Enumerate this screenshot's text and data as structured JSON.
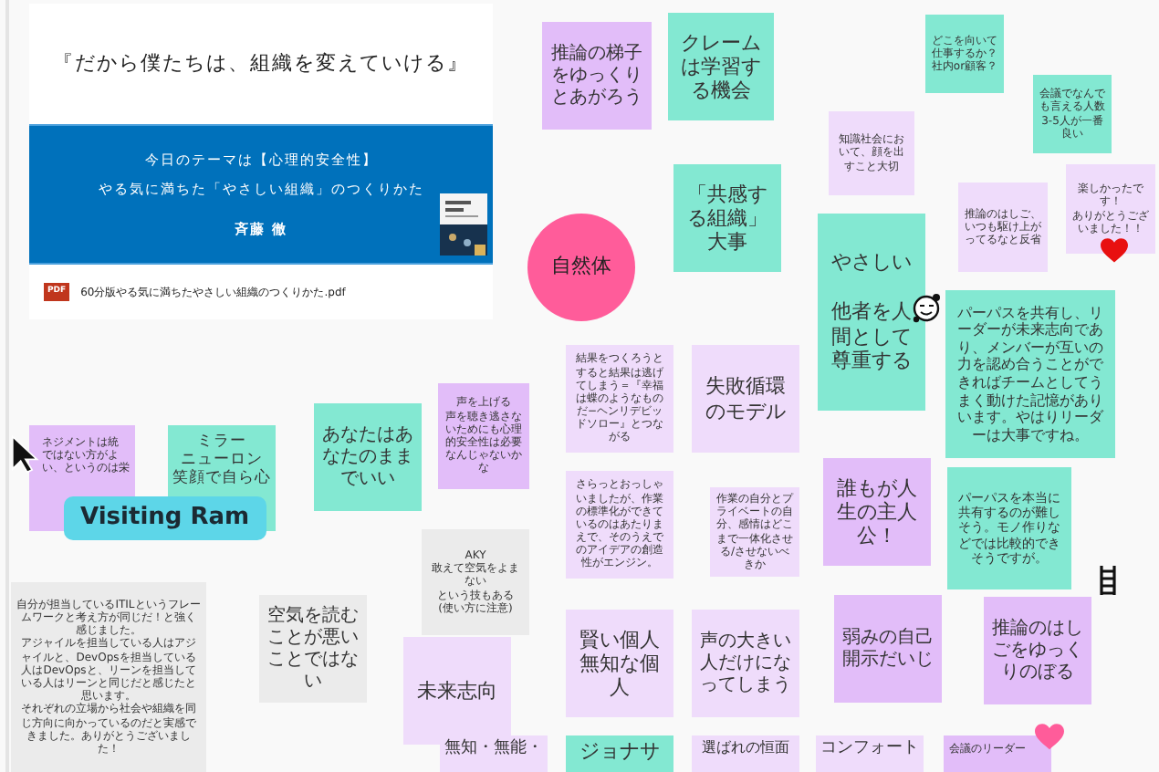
{
  "pdf_card": {
    "title": "『だから僕たちは、組織を変えていける』",
    "banner_lines": [
      "今日のテーマは【心理的安全性】",
      "やる気に満ちた「やさしい組織」のつくりかた",
      "斉藤 徹"
    ],
    "file_badge": "PDF",
    "file_name": "60分版やる気に満ちたやさしい組織のつくりかた.pdf"
  },
  "notes": [
    {
      "kind": "note",
      "color": "#e2bdf9",
      "lines": [
        "ネジメントは統",
        "ではない方がよ",
        "い、というのは栄"
      ]
    },
    {
      "kind": "note",
      "color": "#83e8d2",
      "lines": [
        "ミラー",
        "ニューロン",
        "笑顔で自ら心"
      ]
    },
    {
      "kind": "note",
      "color": "#ebebeb",
      "lines": [
        "自分が担当しているITILというフレームワークと考え方が同じだ！と強く感じました。",
        "アジャイルを担当している人はアジャイルと、DevOpsを担当している人はDevOpsと、リーンを担当している人はリーンと同じだと感じたと思います。",
        "それぞれの立場から社会や組織を同じ方向に向かっているのだと実感できました。ありがとうございました！"
      ]
    },
    {
      "kind": "note",
      "color": "#e2bdf9",
      "lines": [
        "推論の梯子をゆっくりとあがろう"
      ]
    },
    {
      "kind": "note",
      "color": "#83e8d2",
      "lines": [
        "あなたはあなたのままでいい"
      ]
    },
    {
      "kind": "note",
      "color": "#83e8d2",
      "lines": [
        "クレームは学習する機会"
      ]
    },
    {
      "kind": "circle",
      "color": "#ff5c9a",
      "lines": [
        "自然体"
      ]
    },
    {
      "kind": "note",
      "color": "#ebebeb",
      "lines": [
        "空気を読むことが悪いことではない"
      ]
    },
    {
      "kind": "note",
      "color": "#e2bdf9",
      "lines": [
        "声を上げる",
        "声を聴き逃さないためにも心理的安全性は必要なんじゃないかな"
      ]
    },
    {
      "kind": "note",
      "color": "#83e8d2",
      "lines": [
        "「共感する組織」大事"
      ]
    },
    {
      "kind": "note",
      "color": "#efdcfb",
      "lines": [
        "結果をつくろうとすると結果は逃げてしまう＝『幸福は蝶のようなものだ−ヘンリデビッドソロー』とつながる"
      ]
    },
    {
      "kind": "note",
      "color": "#ebebeb",
      "lines": [
        "AKY",
        "敢えて空気をよまない",
        "という技もある",
        "(使い方に注意)"
      ]
    },
    {
      "kind": "note",
      "color": "#efdcfb",
      "lines": [
        "知識社会において、顔を出すこと大切"
      ]
    },
    {
      "kind": "note",
      "color": "#efdcfb",
      "lines": [
        "未来志向"
      ]
    },
    {
      "kind": "note",
      "color": "#83e8d2",
      "lines": [
        "どこを向いて仕事するか？社内or顧客？"
      ]
    },
    {
      "kind": "note",
      "color": "#efdcfb",
      "lines": [
        "さらっとおっしゃいましたが、作業の標準化ができているのはあたりまえで、そのうえでのアイデアの創造性がエンジン。"
      ]
    },
    {
      "kind": "note",
      "color": "#efdcfb",
      "lines": [
        "失敗循環のモデル"
      ]
    },
    {
      "kind": "note",
      "color": "#83e8d2",
      "lines": [
        "やさしい"
      ],
      "subtext": "他者を人間として尊重する"
    },
    {
      "kind": "note",
      "color": "#efdcfb",
      "lines": [
        "無知・無能・"
      ]
    },
    {
      "kind": "note",
      "color": "#efdcfb",
      "lines": [
        "賢い個人",
        "無知な個人"
      ]
    },
    {
      "kind": "note",
      "color": "#83e8d2",
      "lines": [
        "会議でなんでも言える人数3-5人が一番良い"
      ]
    },
    {
      "kind": "note",
      "color": "#efdcfb",
      "lines": [
        "推論のはしご、いつも駆け上がってるなと反省"
      ]
    },
    {
      "kind": "note",
      "color": "#efdcfb",
      "lines": [
        "作業の自分とプライベートの自分、感情はどこまで一体化させる/させないべきか"
      ]
    },
    {
      "kind": "note",
      "color": "#83e8d2",
      "lines": [
        "ジョナサ"
      ]
    },
    {
      "kind": "note",
      "color": "#efdcfb",
      "lines": [
        "楽しかったです！",
        "ありがとうございました！！"
      ]
    },
    {
      "kind": "note",
      "color": "#83e8d2",
      "lines": [
        "パーパスを共有し、リーダーが未来志向であり、メンバーが互いの力を認め合うことができればチームとしてうまく動けた記憶がありいます。やはりリーダーは大事ですね。"
      ]
    },
    {
      "kind": "note",
      "color": "#efdcfb",
      "lines": [
        "声の大きい人だけになってしまう"
      ]
    },
    {
      "kind": "note",
      "color": "#e2bdf9",
      "lines": [
        "誰もが人生の主人公！"
      ]
    },
    {
      "kind": "note",
      "color": "#efdcfb",
      "lines": [
        "選ばれの恒面"
      ]
    },
    {
      "kind": "note",
      "color": "#e2bdf9",
      "lines": [
        "弱みの自己開示だいじ"
      ]
    },
    {
      "kind": "note",
      "color": "#83e8d2",
      "lines": [
        "パーパスを本当に共有するのが難しそう。モノ作りなどでは比較的できそうですが。"
      ]
    },
    {
      "kind": "note",
      "color": "#efdcfb",
      "lines": [
        "コンフォート"
      ]
    },
    {
      "kind": "note",
      "color": "#e2bdf9",
      "lines": [
        "推論のはしごをゆっくりのぼる"
      ]
    },
    {
      "kind": "note",
      "color": "#e2bdf9",
      "lines": [
        "会議のリーダー"
      ]
    }
  ],
  "cursor_label": {
    "text": "Visiting Ram"
  }
}
